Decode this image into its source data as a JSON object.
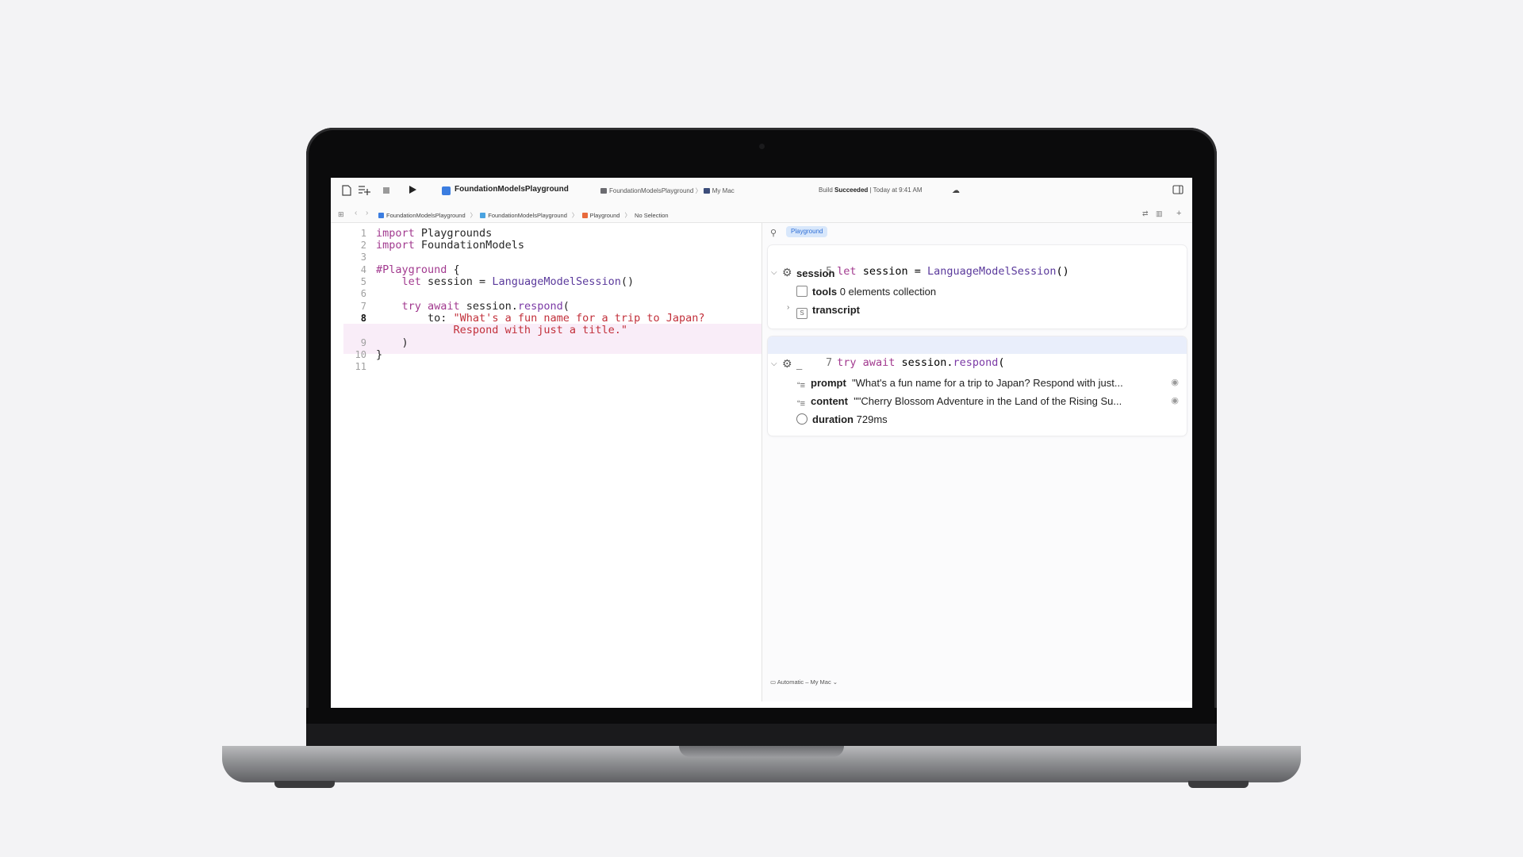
{
  "toolbar": {
    "project_title": "FoundationModelsPlayground",
    "scheme_name": "FoundationModelsPlayground",
    "run_destination": "My Mac",
    "build_status_prefix": "Build",
    "build_status_result": "Succeeded",
    "build_status_time": "| Today at 9:41 AM"
  },
  "breadcrumb": {
    "items": [
      "FoundationModelsPlayground",
      "FoundationModelsPlayground",
      "Playground",
      "No Selection"
    ],
    "separator": "〉"
  },
  "editor": {
    "lines": [
      {
        "n": "1",
        "tokens": [
          [
            "kw",
            "import"
          ],
          [
            "",
            " Playgrounds"
          ]
        ]
      },
      {
        "n": "2",
        "tokens": [
          [
            "kw",
            "import"
          ],
          [
            "",
            " FoundationModels"
          ]
        ]
      },
      {
        "n": "3",
        "tokens": []
      },
      {
        "n": "4",
        "tokens": [
          [
            "kw",
            "#Playground"
          ],
          [
            "",
            " {"
          ]
        ]
      },
      {
        "n": "5",
        "tokens": [
          [
            "",
            "    "
          ],
          [
            "kw",
            "let"
          ],
          [
            "",
            " session = "
          ],
          [
            "ty",
            "LanguageModelSession"
          ],
          [
            "",
            "()"
          ]
        ]
      },
      {
        "n": "6",
        "tokens": []
      },
      {
        "n": "7",
        "tokens": [
          [
            "",
            "    "
          ],
          [
            "kw",
            "try await"
          ],
          [
            "",
            " session."
          ],
          [
            "fn",
            "respond"
          ],
          [
            "",
            "("
          ]
        ]
      },
      {
        "n": "8",
        "tokens": [
          [
            "",
            "        to: "
          ],
          [
            "str",
            "\"What's a fun name for a trip to Japan?"
          ]
        ]
      },
      {
        "n": "",
        "tokens": [
          [
            "str",
            "            Respond with just a title.\""
          ]
        ]
      },
      {
        "n": "9",
        "tokens": [
          [
            "",
            "    )"
          ]
        ]
      },
      {
        "n": "10",
        "tokens": [
          [
            "",
            "}"
          ]
        ]
      },
      {
        "n": "11",
        "tokens": []
      }
    ],
    "active_line": "8"
  },
  "results": {
    "badge": "Playground",
    "card1": {
      "line_number": "5",
      "code_kw": "let",
      "code_rest": " session = ",
      "code_type": "LanguageModelSession",
      "code_end": "()",
      "root_name": "session",
      "tools_label": "tools",
      "tools_value": "0 elements collection",
      "transcript_label": "transcript"
    },
    "card2": {
      "line_number": "7",
      "code_kw": "try await",
      "code_rest": " session.",
      "code_fn": "respond",
      "code_end": "(",
      "root_name": "_",
      "prompt_label": "prompt",
      "prompt_value": "\"What's a fun name for a trip to Japan? Respond with just...",
      "content_label": "content",
      "content_value": "\"\"Cherry Blossom Adventure in the Land of the Rising Su...",
      "duration_label": "duration",
      "duration_value": "729ms"
    },
    "destination": "Automatic – My Mac"
  },
  "colors": {
    "keyword": "#a23a8f",
    "string": "#c2303b",
    "badge_bg": "#d8e7fb",
    "highlight_line": "#f9edf8"
  }
}
